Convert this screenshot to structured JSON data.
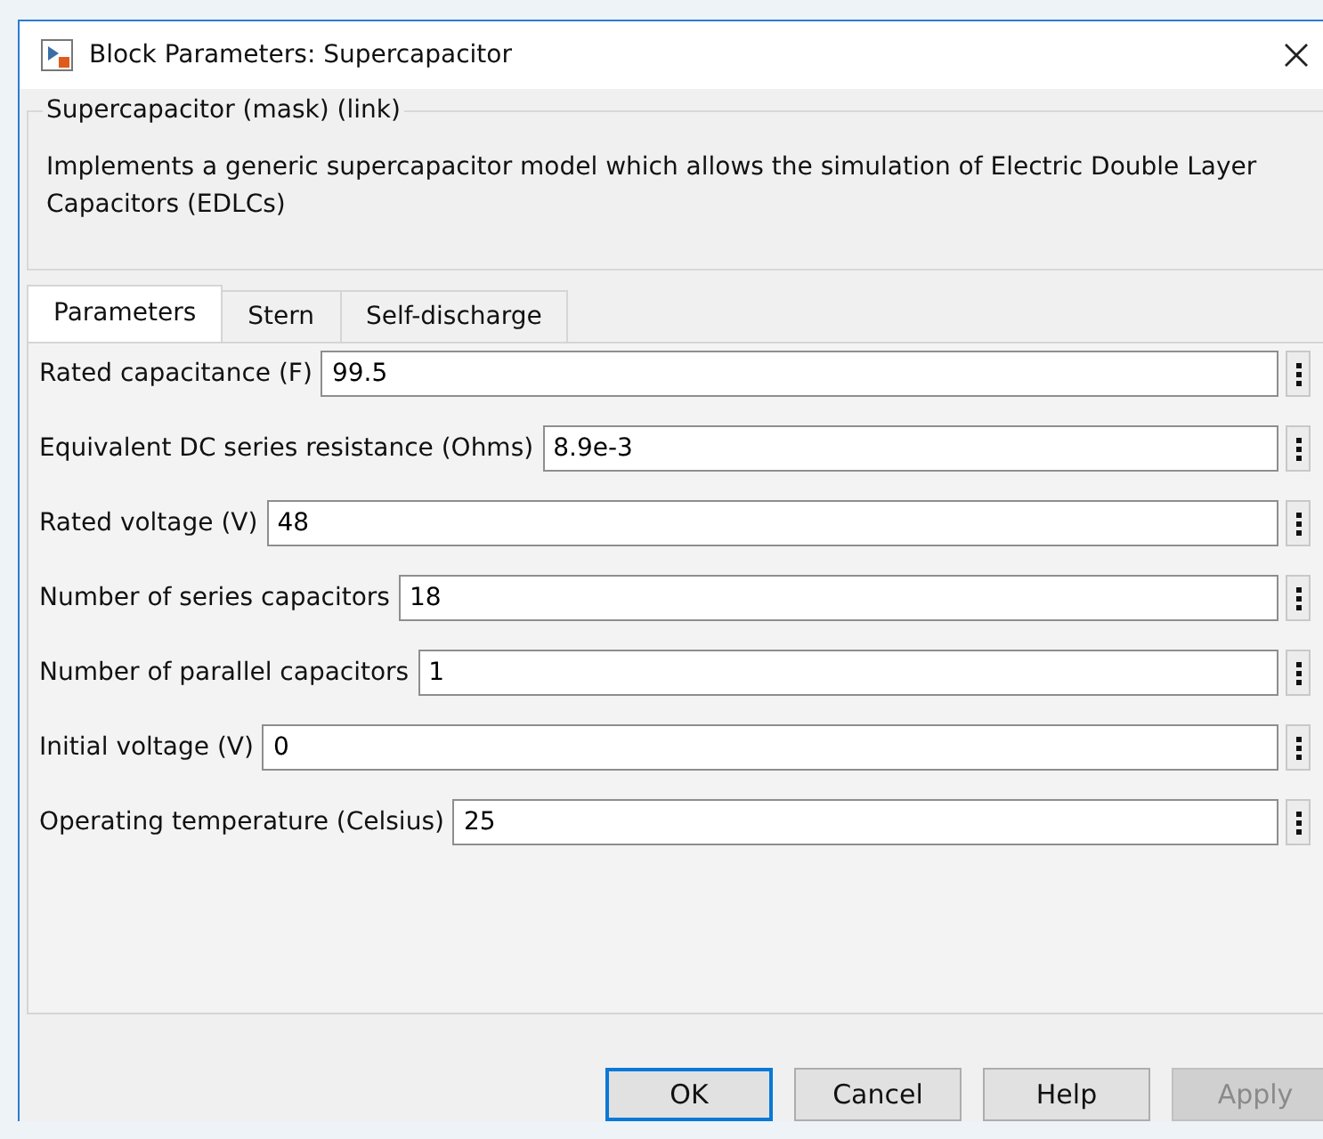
{
  "window": {
    "title": "Block Parameters: Supercapacitor"
  },
  "description": {
    "heading": "Supercapacitor (mask) (link)",
    "text": "Implements a generic supercapacitor model which allows the simulation of Electric Double Layer Capacitors (EDLCs)"
  },
  "tabs": [
    {
      "label": "Parameters",
      "selected": true
    },
    {
      "label": "Stern",
      "selected": false
    },
    {
      "label": "Self-discharge",
      "selected": false
    }
  ],
  "parameters": [
    {
      "label": "Rated capacitance (F)",
      "value": "99.5"
    },
    {
      "label": "Equivalent DC series resistance (Ohms)",
      "value": "8.9e-3"
    },
    {
      "label": "Rated voltage (V)",
      "value": "48"
    },
    {
      "label": "Number of series capacitors",
      "value": "18"
    },
    {
      "label": "Number of parallel capacitors",
      "value": "1"
    },
    {
      "label": "Initial voltage (V)",
      "value": "0"
    },
    {
      "label": "Operating temperature (Celsius)",
      "value": "25"
    }
  ],
  "buttons": [
    {
      "label": "OK",
      "default": true,
      "disabled": false
    },
    {
      "label": "Cancel",
      "default": false,
      "disabled": false
    },
    {
      "label": "Help",
      "default": false,
      "disabled": false
    },
    {
      "label": "Apply",
      "default": false,
      "disabled": true
    }
  ]
}
